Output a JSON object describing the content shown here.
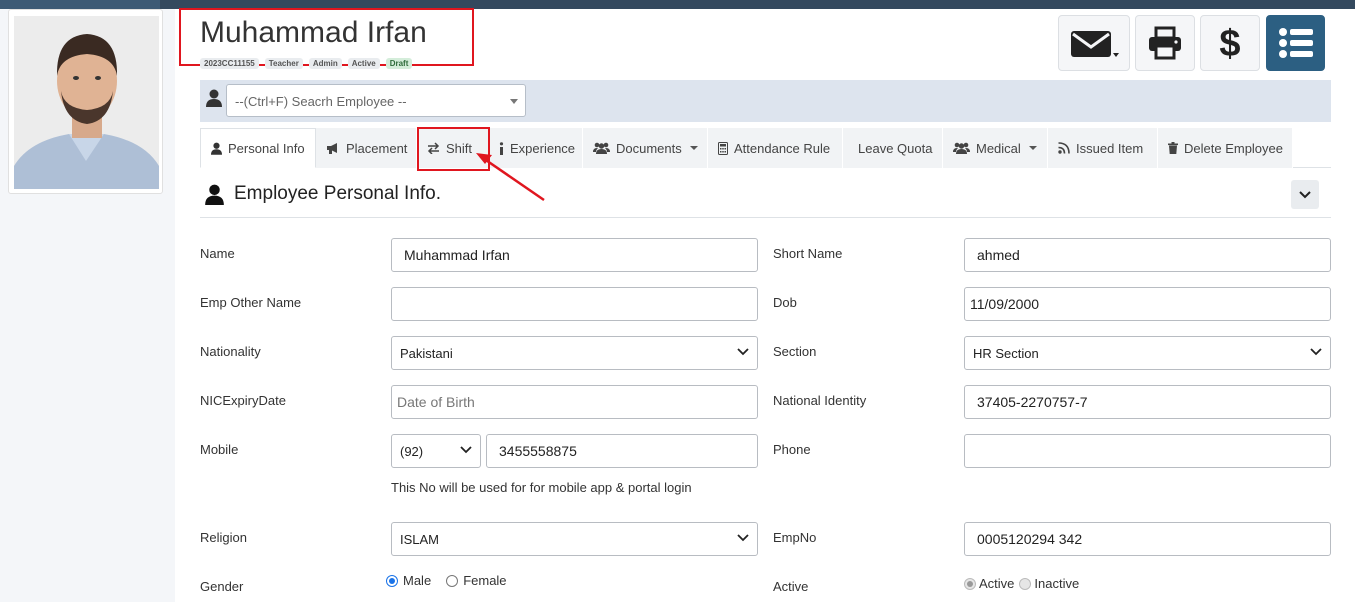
{
  "employee": {
    "name": "Muhammad Irfan",
    "badges": [
      "2023CC11155",
      "Teacher",
      "Admin",
      "Active",
      "Draft"
    ]
  },
  "search": {
    "placeholder": "--(Ctrl+F) Seacrh Employee --"
  },
  "tabs": [
    {
      "label": "Personal Info",
      "icon": "user-icon"
    },
    {
      "label": "Placement",
      "icon": "bullhorn-icon"
    },
    {
      "label": "Shift",
      "icon": "exchange-icon"
    },
    {
      "label": "Experience",
      "icon": "info-icon"
    },
    {
      "label": "Documents",
      "icon": "users-icon"
    },
    {
      "label": "Attendance Rule",
      "icon": "calculator-icon"
    },
    {
      "label": "Leave Quota",
      "icon": ""
    },
    {
      "label": "Medical",
      "icon": "users-icon"
    },
    {
      "label": "Issued Item",
      "icon": "rss-icon"
    },
    {
      "label": "Delete Employee",
      "icon": "trash-icon"
    }
  ],
  "section": {
    "title": "Employee Personal Info."
  },
  "form": {
    "name_label": "Name",
    "name_value": "Muhammad Irfan",
    "short_name_label": "Short Name",
    "short_name_value": "ahmed",
    "other_name_label": "Emp Other Name",
    "other_name_value": "",
    "dob_label": "Dob",
    "dob_value": "11/09/2000",
    "nationality_label": "Nationality",
    "nationality_value": "Pakistani",
    "section_label": "Section",
    "section_value": "HR Section",
    "nic_expiry_label": "NICExpiryDate",
    "nic_expiry_placeholder": "Date of Birth",
    "national_identity_label": "National Identity",
    "national_identity_value": "37405-2270757-7",
    "mobile_label": "Mobile",
    "mobile_code": "(92)",
    "mobile_value": "3455558875",
    "mobile_hint": "This No will be used for for mobile app & portal login",
    "phone_label": "Phone",
    "phone_value": "",
    "religion_label": "Religion",
    "religion_value": "ISLAM",
    "empno_label": "EmpNo",
    "empno_value": "0005120294 342",
    "gender_label": "Gender",
    "gender_options": [
      "Male",
      "Female"
    ],
    "gender_selected": "Male",
    "active_label": "Active",
    "active_options": [
      "Active",
      "Inactive"
    ],
    "active_selected": "Active"
  },
  "colors": {
    "accent": "#2c5f82",
    "highlight": "#e0161f",
    "topbar": "#34495e"
  }
}
